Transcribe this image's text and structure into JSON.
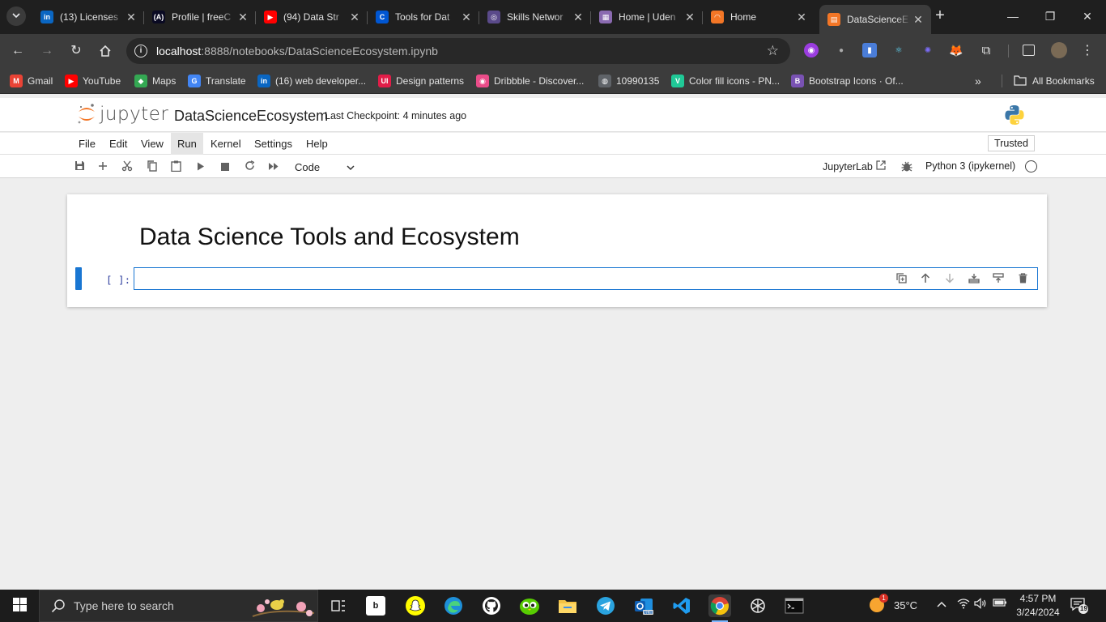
{
  "browser": {
    "tab_search_icon": "chevron-down-icon",
    "tabs": [
      {
        "label": "(13) Licenses",
        "icon": "linkedin-icon",
        "color": "#0a66c2",
        "glyph": "in"
      },
      {
        "label": "Profile | freeC",
        "icon": "freecodecamp-icon",
        "color": "#0a0a23",
        "glyph": "(A)"
      },
      {
        "label": "(94) Data Str",
        "icon": "youtube-icon",
        "color": "#ff0000",
        "glyph": "▶"
      },
      {
        "label": "Tools for Dat",
        "icon": "coursera-icon",
        "color": "#0056d2",
        "glyph": "C"
      },
      {
        "label": "Skills Networ",
        "icon": "skills-network-icon",
        "color": "#5a4a8a",
        "glyph": "◎"
      },
      {
        "label": "Home | Uden",
        "icon": "udemy-icon",
        "color": "#8a6ab0",
        "glyph": "▦"
      },
      {
        "label": "Home",
        "icon": "jupyter-icon",
        "color": "#f37626",
        "glyph": "◠"
      },
      {
        "label": "DataScienceE",
        "icon": "notebook-icon",
        "color": "#f37626",
        "glyph": "▤"
      }
    ],
    "url_host": "localhost",
    "url_path": ":8888/notebooks/DataScienceEcosystem.ipynb",
    "bookmarks": [
      {
        "label": "Gmail",
        "icon": "gmail-icon",
        "color": "#ea4335",
        "glyph": "M"
      },
      {
        "label": "YouTube",
        "icon": "youtube-icon",
        "color": "#ff0000",
        "glyph": "▶"
      },
      {
        "label": "Maps",
        "icon": "maps-icon",
        "color": "#34a853",
        "glyph": "◆"
      },
      {
        "label": "Translate",
        "icon": "translate-icon",
        "color": "#4285f4",
        "glyph": "G"
      },
      {
        "label": "(16) web developer...",
        "icon": "linkedin-icon",
        "color": "#0a66c2",
        "glyph": "in"
      },
      {
        "label": "Design patterns",
        "icon": "uidesign-icon",
        "color": "#e11d48",
        "glyph": "UI"
      },
      {
        "label": "Dribbble - Discover...",
        "icon": "dribbble-icon",
        "color": "#ea4c89",
        "glyph": "◉"
      },
      {
        "label": "10990135",
        "icon": "globe-icon",
        "color": "#5f6368",
        "glyph": "◍"
      },
      {
        "label": "Color fill icons - PN...",
        "icon": "vuesax-icon",
        "color": "#20c997",
        "glyph": "V"
      },
      {
        "label": "Bootstrap Icons · Of...",
        "icon": "bootstrap-icon",
        "color": "#7952b3",
        "glyph": "B"
      }
    ],
    "all_bookmarks": "All Bookmarks"
  },
  "jupyter": {
    "logo_text": "jupyter",
    "notebook_name": "DataScienceEcosystem",
    "checkpoint": "Last Checkpoint: 4 minutes ago",
    "menus": [
      "File",
      "Edit",
      "View",
      "Run",
      "Kernel",
      "Settings",
      "Help"
    ],
    "trusted": "Trusted",
    "cell_type": "Code",
    "jupyterlab_label": "JupyterLab",
    "kernel_name": "Python 3 (ipykernel)"
  },
  "notebook": {
    "heading": "Data Science Tools and Ecosystem",
    "prompt": "[ ]:"
  },
  "taskbar": {
    "search_placeholder": "Type here to search",
    "temperature": "35°C",
    "time": "4:57 PM",
    "date": "3/24/2024",
    "notification_count": "19",
    "weather_badge": "1"
  }
}
